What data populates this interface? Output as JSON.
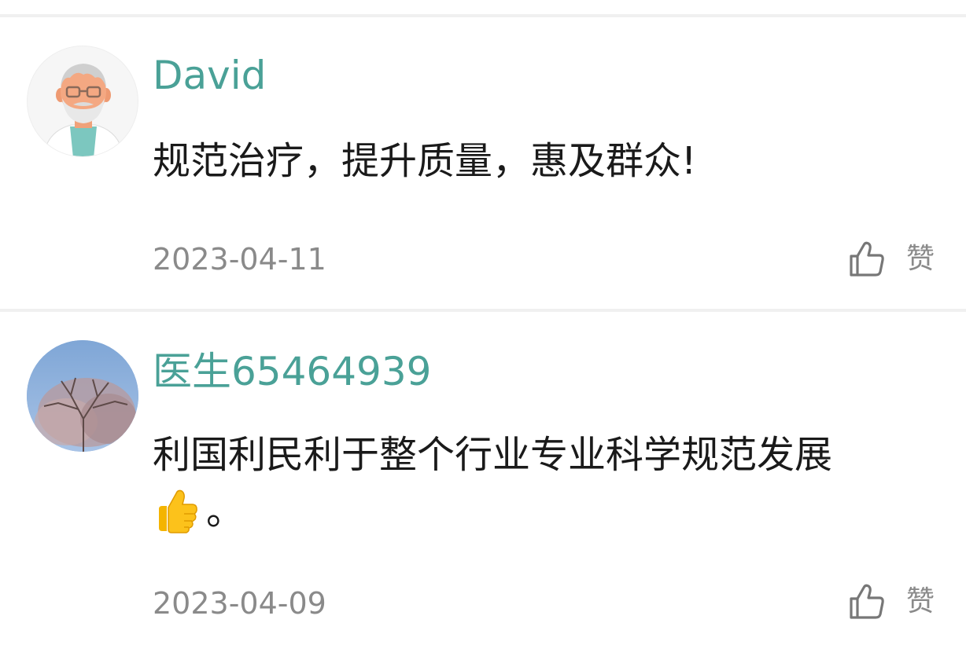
{
  "comments": [
    {
      "username": "David",
      "avatar_icon": "doctor-avatar-icon",
      "text": "规范治疗，提升质量，惠及群众!",
      "date": "2023-04-11",
      "like_label": "赞"
    },
    {
      "username": "医生65464939",
      "avatar_icon": "tree-photo-avatar",
      "text": "利国利民利于整个行业专业科学规范发展",
      "text_suffix": "。",
      "emoji": "thumbs-up-emoji",
      "date": "2023-04-09",
      "like_label": "赞"
    }
  ],
  "colors": {
    "username": "#4aa197",
    "text": "#1a1a1a",
    "meta": "#8a8a8a",
    "divider": "#f0f0f0"
  }
}
